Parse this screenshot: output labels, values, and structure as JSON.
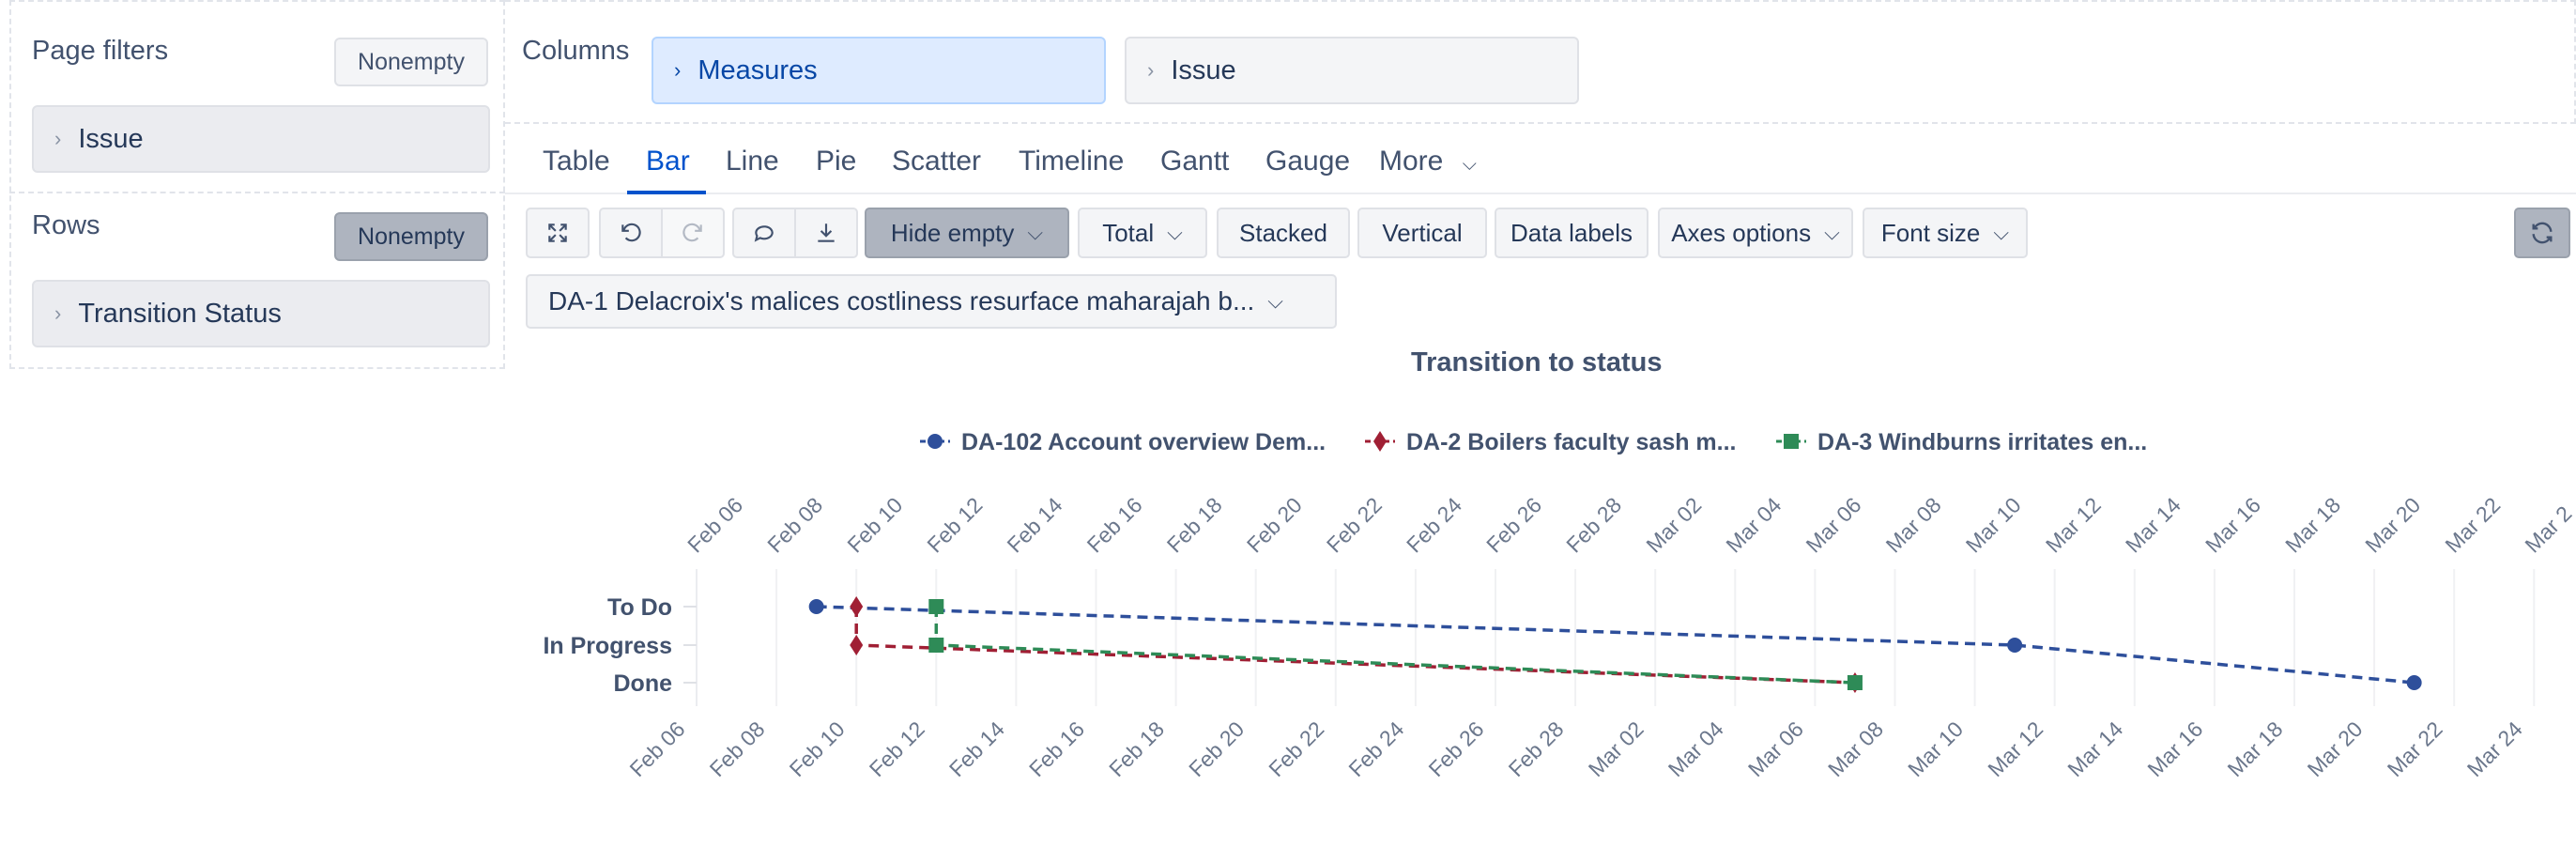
{
  "left_panel": {
    "page_filters_title": "Page filters",
    "page_filters_button": "Nonempty",
    "page_filter_item": "Issue",
    "rows_title": "Rows",
    "rows_button": "Nonempty",
    "rows_item": "Transition Status"
  },
  "columns": {
    "title": "Columns",
    "items": [
      "Measures",
      "Issue"
    ]
  },
  "tabs": [
    "Table",
    "Bar",
    "Line",
    "Pie",
    "Scatter",
    "Timeline",
    "Gantt",
    "Gauge",
    "More"
  ],
  "active_tab": "Bar",
  "toolbar": {
    "hide_empty": "Hide empty",
    "total": "Total",
    "stacked": "Stacked",
    "vertical": "Vertical",
    "data_labels": "Data labels",
    "axes_options": "Axes options",
    "font_size": "Font size"
  },
  "issue_selector": "DA-1 Delacroix's malices costliness resurface maharajah b...",
  "chart_data": {
    "type": "line",
    "title": "Transition to status",
    "y_categories": [
      "To Do",
      "In Progress",
      "Done"
    ],
    "x_ticks_top": [
      "Feb 06",
      "Feb 08",
      "Feb 10",
      "Feb 12",
      "Feb 14",
      "Feb 16",
      "Feb 18",
      "Feb 20",
      "Feb 22",
      "Feb 24",
      "Feb 26",
      "Feb 28",
      "Mar 02",
      "Mar 04",
      "Mar 06",
      "Mar 08",
      "Mar 10",
      "Mar 12",
      "Mar 14",
      "Mar 16",
      "Mar 18",
      "Mar 20",
      "Mar 22",
      "Mar 2"
    ],
    "x_ticks_bottom": [
      "Feb 06",
      "Feb 08",
      "Feb 10",
      "Feb 12",
      "Feb 14",
      "Feb 16",
      "Feb 18",
      "Feb 20",
      "Feb 22",
      "Feb 24",
      "Feb 26",
      "Feb 28",
      "Mar 02",
      "Mar 04",
      "Mar 06",
      "Mar 08",
      "Mar 10",
      "Mar 12",
      "Mar 14",
      "Mar 16",
      "Mar 18",
      "Mar 20",
      "Mar 22",
      "Mar 24"
    ],
    "series": [
      {
        "name": "DA-102 Account overview Dem...",
        "color": "#2e4f9b",
        "marker": "circle",
        "points": [
          {
            "x": "2024-02-09",
            "y": "To Do"
          },
          {
            "x": "2024-03-10",
            "y": "In Progress"
          },
          {
            "x": "2024-03-20",
            "y": "Done"
          }
        ]
      },
      {
        "name": "DA-2 Boilers faculty sash m...",
        "color": "#a01f34",
        "marker": "diamond",
        "points": [
          {
            "x": "2024-02-10",
            "y": "To Do"
          },
          {
            "x": "2024-02-10",
            "y": "In Progress"
          },
          {
            "x": "2024-03-06",
            "y": "Done"
          }
        ]
      },
      {
        "name": "DA-3 Windburns irritates en...",
        "color": "#2e8b57",
        "marker": "square",
        "points": [
          {
            "x": "2024-02-12",
            "y": "To Do"
          },
          {
            "x": "2024-02-12",
            "y": "In Progress"
          },
          {
            "x": "2024-03-06",
            "y": "Done"
          }
        ]
      }
    ]
  }
}
